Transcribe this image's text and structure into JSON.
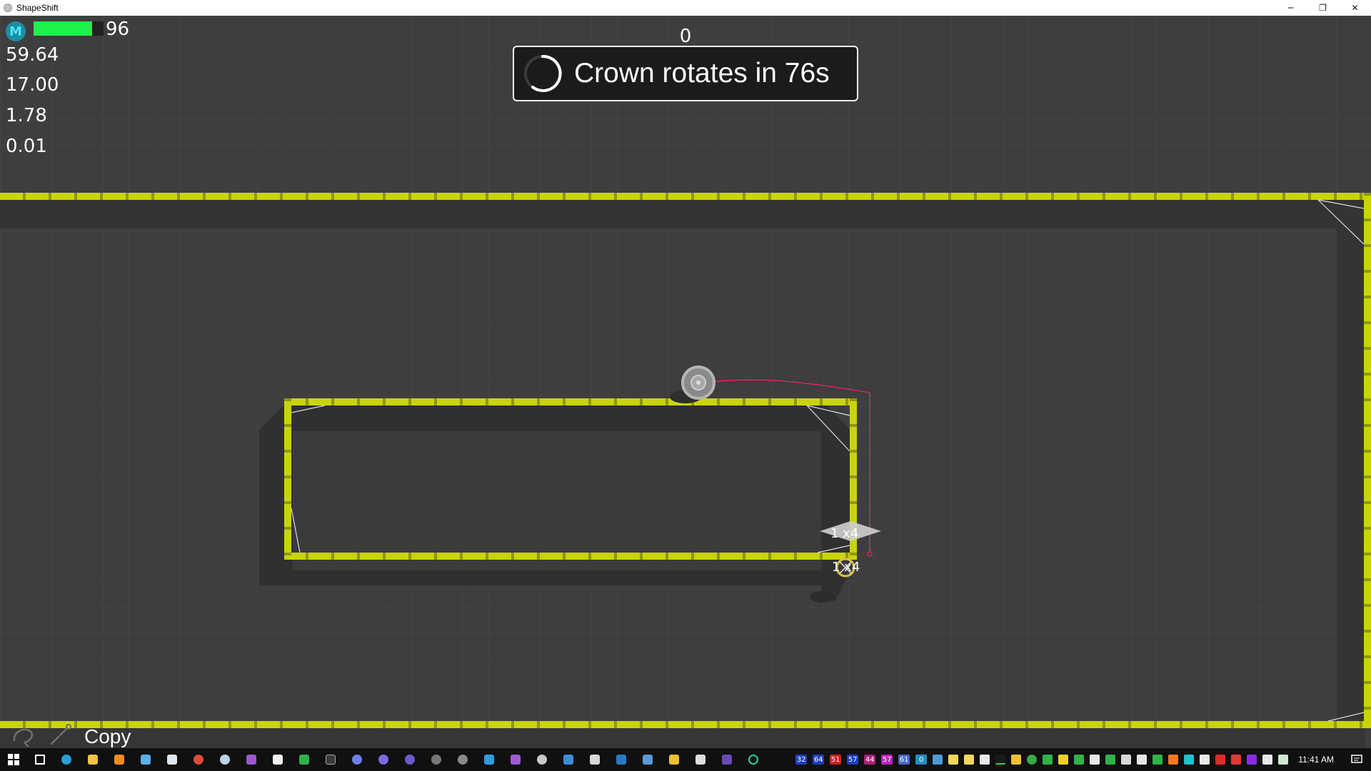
{
  "window": {
    "title": "ShapeShift",
    "minimize_glyph": "─",
    "restore_glyph": "❐",
    "close_glyph": "✕"
  },
  "hud": {
    "avatar_letter": "M",
    "health_value": 96,
    "health_fraction": 0.84,
    "health_label": "96",
    "stats": [
      "59.64",
      "17.00",
      "1.78",
      "0.01"
    ],
    "score": "0",
    "crown_message": "Crown rotates in 76s",
    "spinner_icon": "spinner-icon",
    "tool_label": "Copy",
    "colors": {
      "health": "#1ff04a",
      "wall": "#c9d40a",
      "trail": "#e0206a"
    }
  },
  "markers": {
    "label_upper": "1 x4",
    "label_lower": "1 x4"
  },
  "taskbar": {
    "tray_numbers": [
      "32",
      "64",
      "51",
      "57",
      "44",
      "57",
      "61",
      "0"
    ],
    "clock": "11:41 AM",
    "notification_icon": "notification-icon"
  }
}
